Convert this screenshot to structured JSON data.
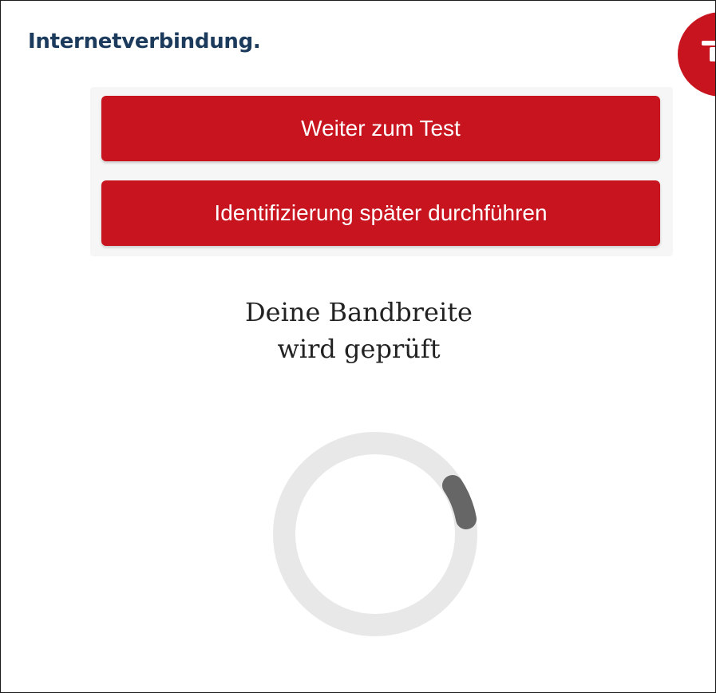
{
  "header": {
    "text": "Internetverbindung."
  },
  "actions": {
    "continue_label": "Weiter zum Test",
    "later_label": "Identifizierung später durchführen"
  },
  "status": {
    "line1": "Deine Bandbreite",
    "line2": "wird geprüft"
  },
  "colors": {
    "brand_red": "#c8141e",
    "header_text": "#1b3a5c",
    "spinner_track": "#e8e8e8",
    "spinner_arc": "#666666"
  },
  "icons": {
    "help_fab": "help-icon",
    "loader": "loading-spinner"
  }
}
